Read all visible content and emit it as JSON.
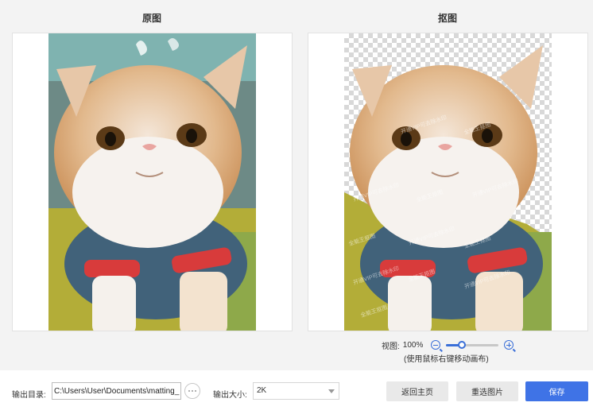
{
  "panels": {
    "original_title": "原图",
    "matting_title": "抠图"
  },
  "watermark_lines": [
    "开通VIP可去除水印",
    "全能王抠图",
    "开通VIP可去除水印",
    "全能王抠图",
    "开通VIP可去除水印",
    "全能王抠图",
    "开通VIP可去除水印",
    "全能王抠图",
    "开通VIP可去除水印",
    "全能王抠图",
    "开通VIP可去除水印",
    "全能王抠图"
  ],
  "view": {
    "label": "视图:",
    "zoom": "100%",
    "slider_level": 0.3,
    "hint": "(使用鼠标右键移动画布)"
  },
  "bottom": {
    "output_dir_label": "输出目录:",
    "output_dir_value": "C:\\Users\\User\\Documents\\matting_",
    "output_size_label": "输出大小:",
    "output_size_value": "2K",
    "home_button": "返回主页",
    "reselect_button": "重选图片",
    "save_button": "保存"
  },
  "colors": {
    "accent": "#3f73e6",
    "background": "#f3f3f3"
  }
}
